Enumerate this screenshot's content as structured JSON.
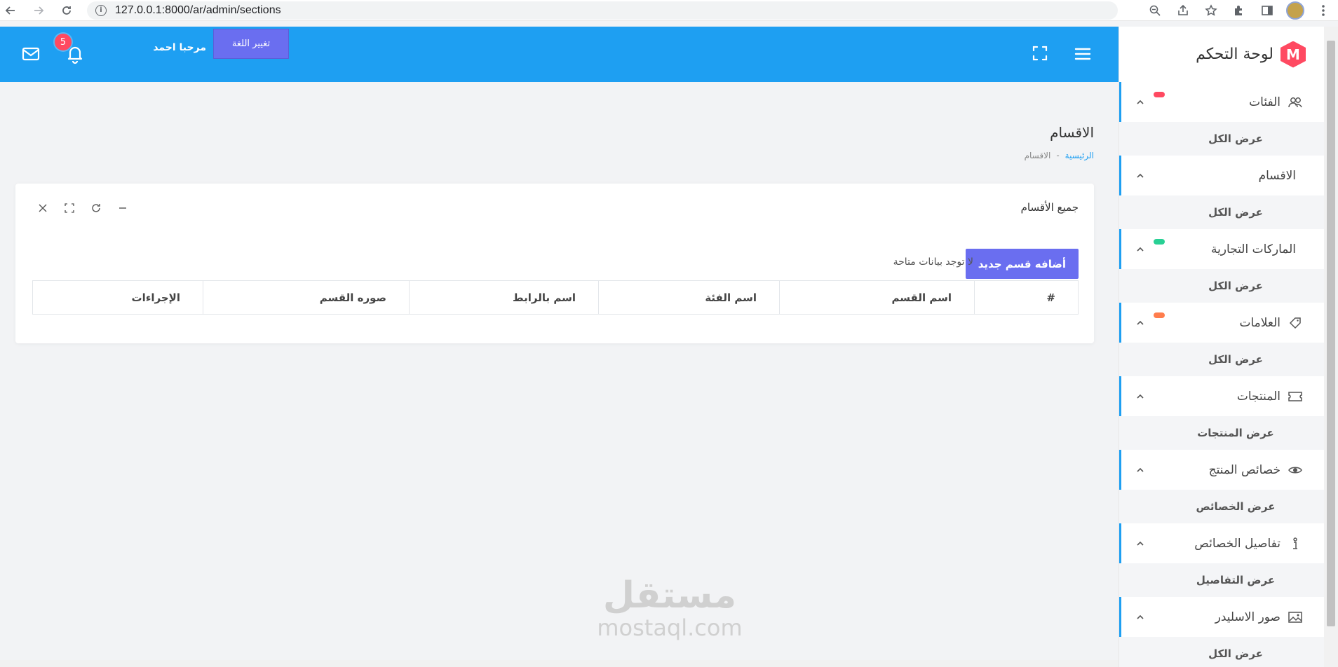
{
  "browser": {
    "url": "127.0.0.1:8000/ar/admin/sections"
  },
  "header": {
    "lang_button": "تغيير اللغة",
    "welcome": "مرحبا احمد",
    "notification_count": "5"
  },
  "sidebar": {
    "brand_title": "لوحة التحكم",
    "brand_letter": "M",
    "items": [
      {
        "label": "الفئات",
        "icon": "users-icon",
        "pill": "#ff4961",
        "sub": "عرض الكل"
      },
      {
        "label": "الاقسام",
        "icon": "",
        "pill": "",
        "sub": "عرض الكل"
      },
      {
        "label": "الماركات التجارية",
        "icon": "",
        "pill": "#28d094",
        "sub": "عرض الكل"
      },
      {
        "label": "العلامات",
        "icon": "tag-icon",
        "pill": "#ff7d4d",
        "sub": "عرض الكل"
      },
      {
        "label": "المنتجات",
        "icon": "ticket-icon",
        "pill": "",
        "sub": "عرض المنتجات"
      },
      {
        "label": "خصائص المنتج",
        "icon": "eye-icon",
        "pill": "",
        "sub": "عرض الخصائص"
      },
      {
        "label": "تفاصيل الخصائص",
        "icon": "info-icon",
        "pill": "",
        "sub": "عرض التفاصيل"
      },
      {
        "label": "صور الاسليدر",
        "icon": "image-icon",
        "pill": "",
        "sub": "عرض الكل"
      }
    ]
  },
  "content": {
    "page_title": "الاقسام",
    "breadcrumb_home": "الرئيسية",
    "breadcrumb_sep": "-",
    "breadcrumb_current": "الاقسام",
    "card_title": "جميع الأقسام",
    "add_button": "أضافه قسم جديد",
    "no_data": "لا توجد بيانات متاحة",
    "table_headers": [
      "#",
      "اسم القسم",
      "اسم الفئة",
      "اسم بالرابط",
      "صوره القسم",
      "الإجراءات"
    ]
  },
  "watermark": {
    "ar": "مستقل",
    "en": "mostaql.com"
  }
}
